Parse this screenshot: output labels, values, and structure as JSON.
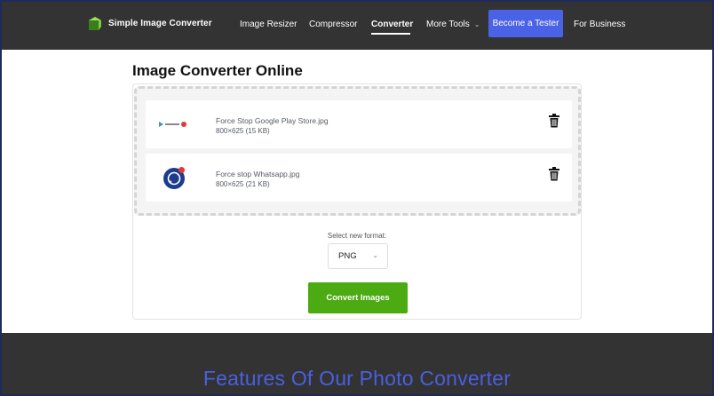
{
  "header": {
    "brand": "Simple Image Converter",
    "nav": [
      {
        "label": "Image Resizer"
      },
      {
        "label": "Compressor"
      },
      {
        "label": "Converter",
        "active": true
      },
      {
        "label": "More Tools"
      },
      {
        "label": "Become a Tester"
      },
      {
        "label": "For Business"
      }
    ]
  },
  "main": {
    "title": "Image Converter Online",
    "files": [
      {
        "name": "Force Stop Google Play Store.jpg",
        "meta": "800×625 (15 KB)"
      },
      {
        "name": "Force stop Whatsapp.jpg",
        "meta": "800×625 (21 KB)"
      }
    ],
    "format_label": "Select new format:",
    "format_value": "PNG",
    "convert_label": "Convert Images"
  },
  "features": {
    "title": "Features Of Our Photo Converter"
  },
  "colors": {
    "header_bg": "#333333",
    "accent_blue": "#4a62e6",
    "convert_green": "#4caa12"
  }
}
